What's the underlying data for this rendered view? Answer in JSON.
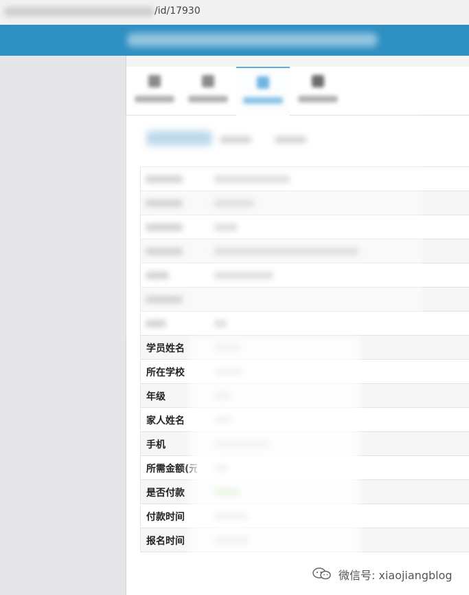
{
  "address_bar": {
    "url_tail": "/id/17930"
  },
  "tabs": [
    {
      "name": "tab-1",
      "active": false
    },
    {
      "name": "tab-2",
      "active": false
    },
    {
      "name": "tab-3",
      "active": true
    },
    {
      "name": "tab-4",
      "active": false
    }
  ],
  "details": {
    "rows": [
      {
        "label": "学员姓名"
      },
      {
        "label": "所在学校"
      },
      {
        "label": "年级"
      },
      {
        "label": "家人姓名"
      },
      {
        "label": "手机"
      },
      {
        "label": "所需金额(元)"
      },
      {
        "label": "是否付款"
      },
      {
        "label": "付款时间"
      },
      {
        "label": "报名时间"
      }
    ]
  },
  "watermark": {
    "text": "微信号: xiaojiangblog",
    "icon": "wechat-icon"
  },
  "colors": {
    "header": "#2e8fc2",
    "active_tab": "#5aaedc",
    "paid_status": "#7ecb6f"
  }
}
